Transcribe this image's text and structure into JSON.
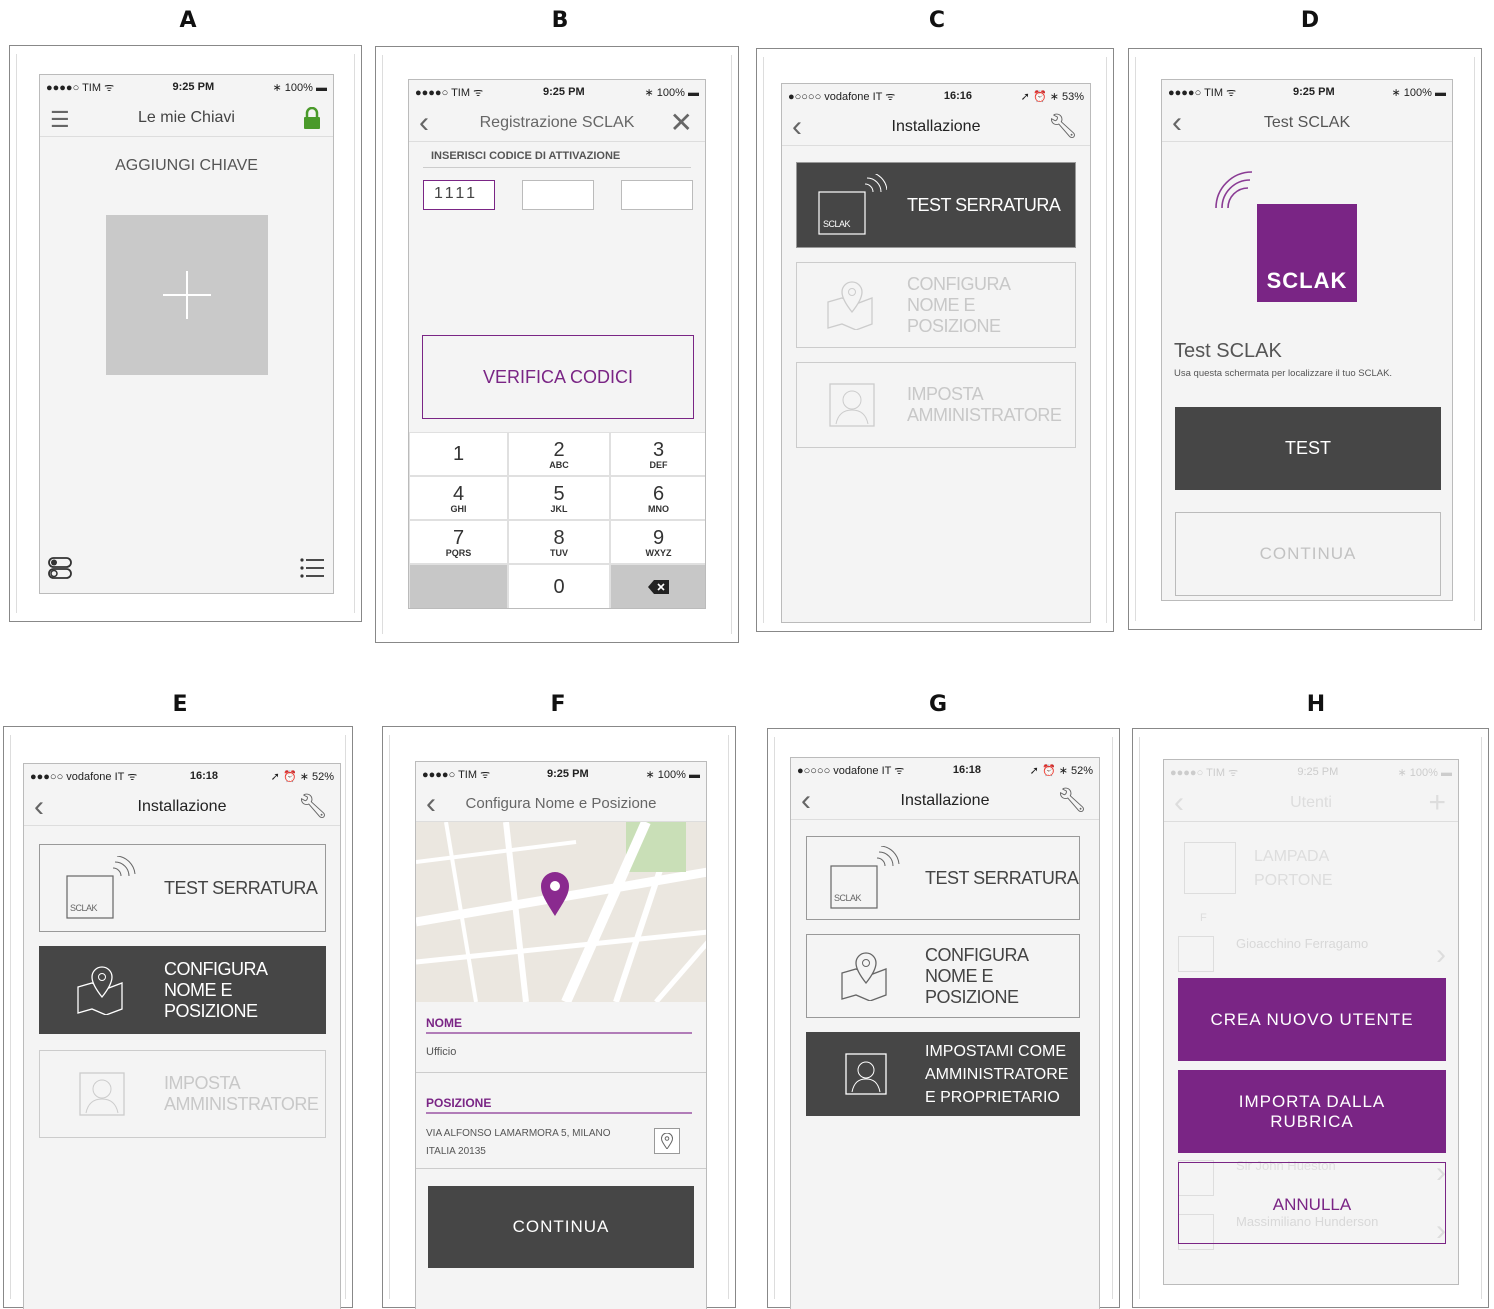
{
  "labels": {
    "a": "A",
    "b": "B",
    "c": "C",
    "d": "D",
    "e": "E",
    "f": "F",
    "g": "G",
    "h": "H"
  },
  "status": {
    "tim": "●●●●○ TIM ᯤ",
    "tim_time": "9:25 PM",
    "tim_batt": "∗ 100% ▬",
    "voda": "●○○○○ vodafone IT ᯤ",
    "voda_e": "●●●○○ vodafone IT ᯤ",
    "voda_time_c": "16:16",
    "voda_time": "16:18",
    "voda_batt_c": "➚ ⏰ ∗ 53%",
    "voda_batt": "➚ ⏰ ∗ 52%"
  },
  "a": {
    "title": "Le mie Chiavi",
    "add_key": "AGGIUNGI CHIAVE",
    "plus": "+"
  },
  "b": {
    "title": "Registrazione SCLAK",
    "section": "INSERISCI CODICE DI ATTIVAZIONE",
    "code1": "1111",
    "verify": "VERIFICA CODICI",
    "keys": [
      {
        "n": "1",
        "s": ""
      },
      {
        "n": "2",
        "s": "ABC"
      },
      {
        "n": "3",
        "s": "DEF"
      },
      {
        "n": "4",
        "s": "GHI"
      },
      {
        "n": "5",
        "s": "JKL"
      },
      {
        "n": "6",
        "s": "MNO"
      },
      {
        "n": "7",
        "s": "PQRS"
      },
      {
        "n": "8",
        "s": "TUV"
      },
      {
        "n": "9",
        "s": "WXYZ"
      }
    ],
    "zero": "0"
  },
  "install": {
    "title": "Installazione",
    "test": "TEST SERRATURA",
    "config": "CONFIGURA NOME E POSIZIONE",
    "admin": "IMPOSTA AMMINISTRATORE",
    "admin_g": "IMPOSTAMI COME AMMINISTRATORE E PROPRIETARIO",
    "sclak_small": "SCLAK"
  },
  "d": {
    "title": "Test SCLAK",
    "logo": "SCLAK",
    "heading": "Test SCLAK",
    "desc": "Usa questa schermata per localizzare il tuo SCLAK.",
    "test": "TEST",
    "continua": "CONTINUA"
  },
  "f": {
    "title": "Configura Nome e Posizione",
    "nome_label": "NOME",
    "nome_value": "Ufficio",
    "pos_label": "POSIZIONE",
    "pos_value1": "VIA ALFONSO LAMARMORA 5, MILANO",
    "pos_value2": "ITALIA 20135",
    "continua": "CONTINUA"
  },
  "h": {
    "title": "Utenti",
    "lamp1": "LAMPADA",
    "lamp2": "PORTONE",
    "section": "F",
    "user1": "Gioacchino Ferragamo",
    "user2": "Sir John Hueston",
    "user3": "Massimiliano Hunderson",
    "crea": "CREA NUOVO UTENTE",
    "importa1": "IMPORTA DALLA",
    "importa2": "RUBRICA",
    "annulla": "ANNULLA"
  },
  "colors": {
    "purple": "#7a2585",
    "dark": "#464646",
    "green": "#4a9a2a"
  }
}
